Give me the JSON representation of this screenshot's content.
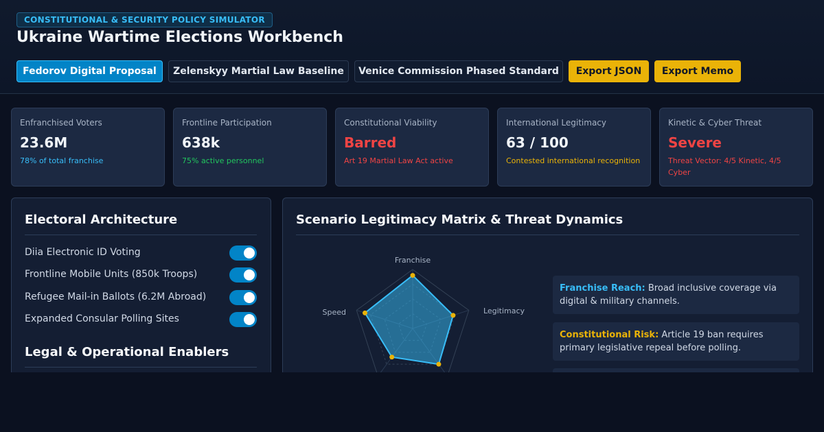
{
  "header": {
    "tag": "CONSTITUTIONAL & SECURITY POLICY SIMULATOR",
    "title": "Ukraine Wartime Elections Workbench"
  },
  "toolbar": {
    "scenarios": [
      {
        "label": "Fedorov Digital Proposal",
        "active": true
      },
      {
        "label": "Zelenskyy Martial Law Baseline",
        "active": false
      },
      {
        "label": "Venice Commission Phased Standard",
        "active": false
      }
    ],
    "export_json": "Export JSON",
    "export_memo": "Export Memo"
  },
  "metrics": [
    {
      "label": "Enfranchised Voters",
      "value": "23.6M",
      "sub": "78% of total franchise",
      "color": "#38bdf8",
      "value_color": "#f1f5f9"
    },
    {
      "label": "Frontline Participation",
      "value": "638k",
      "sub": "75% active personnel",
      "color": "#22c55e",
      "value_color": "#f1f5f9"
    },
    {
      "label": "Constitutional Viability",
      "value": "Barred",
      "sub": "Art 19 Martial Law Act active",
      "color": "#ef4444",
      "value_color": "#ef4444"
    },
    {
      "label": "International Legitimacy",
      "value": "63 / 100",
      "sub": "Contested international recognition",
      "color": "#eab308",
      "value_color": "#f1f5f9"
    },
    {
      "label": "Kinetic & Cyber Threat",
      "value": "Severe",
      "sub": "Threat Vector: 4/5 Kinetic, 4/5 Cyber",
      "color": "#ef4444",
      "value_color": "#ef4444"
    }
  ],
  "architecture": {
    "title": "Electoral Architecture",
    "items": [
      {
        "label": "Diia Electronic ID Voting",
        "on": true
      },
      {
        "label": "Frontline Mobile Units (850k Troops)",
        "on": true
      },
      {
        "label": "Refugee Mail-in Ballots (6.2M Abroad)",
        "on": true
      },
      {
        "label": "Expanded Consular Polling Sites",
        "on": true
      }
    ],
    "enablers_title": "Legal & Operational Enablers"
  },
  "matrix": {
    "title": "Scenario Legitimacy Matrix & Threat Dynamics",
    "radar": {
      "axes": [
        "Franchise",
        "Legitimacy",
        "",
        "",
        "Speed"
      ],
      "values": [
        0.9,
        0.72,
        0.75,
        0.6,
        0.85
      ],
      "color": "#38bdf8",
      "point_color": "#eab308"
    },
    "insights": [
      {
        "key": "Franchise Reach:",
        "text": " Broad inclusive coverage via digital & military channels.",
        "color": "#38bdf8"
      },
      {
        "key": "Constitutional Risk:",
        "text": " Article 19 ban requires primary legislative repeal before polling.",
        "color": "#eab308"
      }
    ]
  }
}
